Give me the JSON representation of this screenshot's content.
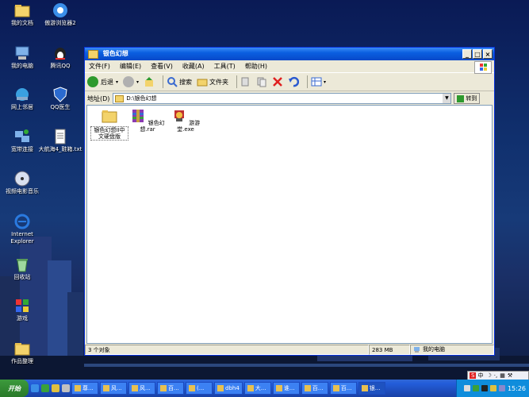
{
  "desktop": {
    "icons": [
      {
        "label": "我的文档"
      },
      {
        "label": "傲游浏览器2"
      },
      {
        "label": "我的电脑"
      },
      {
        "label": "腾讯QQ"
      },
      {
        "label": "网上邻居"
      },
      {
        "label": "QQ医生"
      },
      {
        "label": "宽带连接"
      },
      {
        "label": "大航海4_鞋箱.txt"
      },
      {
        "label": "视频电影音乐"
      },
      {
        "label": "Internet Explorer"
      },
      {
        "label": "回收站"
      },
      {
        "label": "游戏"
      },
      {
        "label": "作品整理"
      }
    ]
  },
  "window": {
    "title": "银色幻想",
    "menu": [
      "文件(F)",
      "编辑(E)",
      "查看(V)",
      "收藏(A)",
      "工具(T)",
      "帮助(H)"
    ],
    "toolbar": {
      "back": "后退",
      "search": "搜索",
      "folders": "文件夹"
    },
    "address": {
      "label": "地址(D)",
      "path": "D:\\银色幻想",
      "go": "转到"
    },
    "files": [
      {
        "name": "银色幻想II中文硬盘版",
        "icon": "folder-icon"
      },
      {
        "name": "银色幻想.rar",
        "icon": "rar-archive-icon"
      },
      {
        "name": "游游堂.exe",
        "icon": "exe-program-icon"
      }
    ],
    "status": {
      "count": "3 个对象",
      "size": "283 MB",
      "location": "我的电脑"
    }
  },
  "taskbar": {
    "start": "开始",
    "tasks": [
      "尊...",
      "风...",
      "风...",
      "百...",
      "(...",
      "dbh4",
      "大...",
      "谁...",
      "百...",
      "百...",
      "银..."
    ],
    "clock": "15:26"
  },
  "ime": {
    "label": "中"
  },
  "colors": {
    "titlebar": "#0a5fe0",
    "taskbar": "#245edb",
    "start": "#3c9a3c",
    "tray": "#0f8ddc"
  }
}
